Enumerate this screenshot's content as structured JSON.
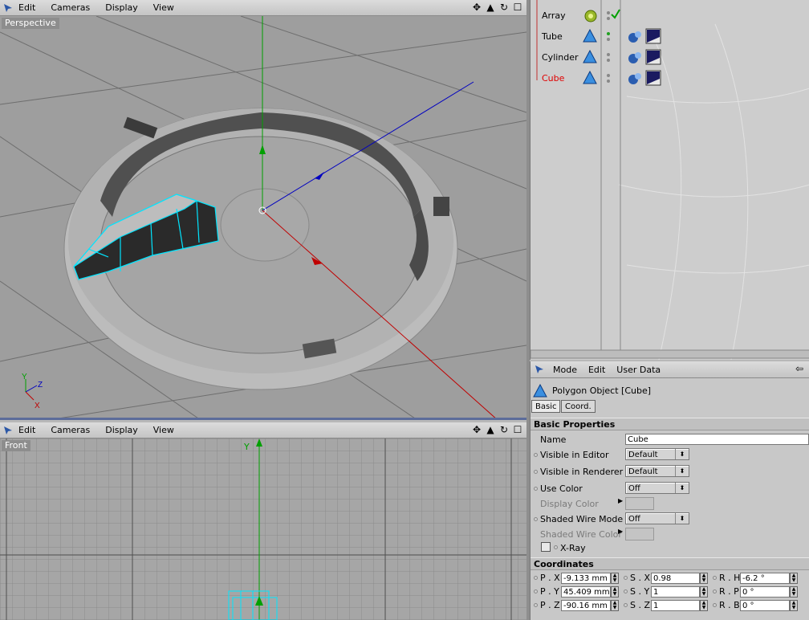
{
  "top_viewport": {
    "menu": [
      "Edit",
      "Cameras",
      "Display",
      "View"
    ],
    "label": "Perspective",
    "axis_labels": {
      "y": "Y",
      "z": "Z",
      "x": "X"
    }
  },
  "bottom_viewport": {
    "menu": [
      "Edit",
      "Cameras",
      "Display",
      "View"
    ],
    "label": "Front",
    "axis_label_y": "Y"
  },
  "object_manager": {
    "objects": [
      {
        "name": "Array",
        "selected": false
      },
      {
        "name": "Tube",
        "selected": false
      },
      {
        "name": "Cylinder",
        "selected": false
      },
      {
        "name": "Cube",
        "selected": true
      }
    ]
  },
  "attribute_manager": {
    "menu": [
      "Mode",
      "Edit",
      "User Data"
    ],
    "object_title": "Polygon Object [Cube]",
    "tabs": [
      "Basic",
      "Coord."
    ],
    "basic_header": "Basic Properties",
    "name_label": "Name",
    "name_value": "Cube",
    "visible_editor_label": "Visible in Editor",
    "visible_editor_value": "Default",
    "visible_renderer_label": "Visible in Renderer",
    "visible_renderer_value": "Default",
    "use_color_label": "Use Color",
    "use_color_value": "Off",
    "display_color_label": "Display Color",
    "shaded_wire_mode_label": "Shaded Wire Mode",
    "shaded_wire_mode_value": "Off",
    "shaded_wire_color_label": "Shaded Wire Color",
    "xray_label": "X-Ray",
    "coord_header": "Coordinates",
    "coords": [
      {
        "pl": "P . X",
        "pv": "-9.133 mm",
        "sl": "S . X",
        "sv": "0.98",
        "rl": "R . H",
        "rv": "-6.2 °"
      },
      {
        "pl": "P . Y",
        "pv": "45.409 mm",
        "sl": "S . Y",
        "sv": "1",
        "rl": "R . P",
        "rv": "0 °"
      },
      {
        "pl": "P . Z",
        "pv": "-90.16 mm",
        "sl": "S . Z",
        "sv": "1",
        "rl": "R . B",
        "rv": "0 °"
      }
    ]
  },
  "colors": {
    "viewport_bg": "#9e9e9e",
    "selection": "#00e5ff",
    "axis_x": "#d00000",
    "axis_y": "#00a000",
    "axis_z": "#0000c0",
    "selected_object": "#e00000"
  }
}
